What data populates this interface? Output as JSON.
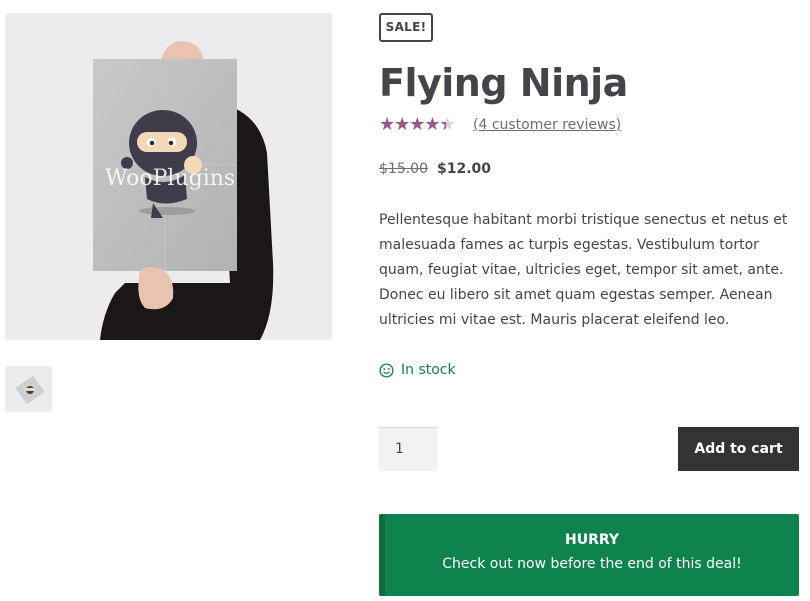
{
  "gallery": {
    "watermark": "WooPlugins",
    "main_image": "poster-held-by-person",
    "thumbnail": "poster-thumbnail"
  },
  "product": {
    "sale_badge": "SALE!",
    "title": "Flying Ninja",
    "rating": 4,
    "rating_max": 5,
    "reviews_link": "(4 customer reviews)",
    "price_old": "$15.00",
    "price_new": "$12.00",
    "description": "Pellentesque habitant morbi tristique senectus et netus et malesuada fames ac turpis egestas. Vestibulum tortor quam, feugiat vitae, ultricies eget, tempor sit amet, ante. Donec eu libero sit amet quam egestas semper. Aenean ultricies mi vitae est. Mauris placerat eleifend leo.",
    "stock_icon": "smiley-icon",
    "stock_text": "In stock",
    "quantity": "1",
    "add_to_cart": "Add to cart"
  },
  "notice": {
    "heading": "HURRY",
    "message": "Check out now before the end of this deal!"
  },
  "colors": {
    "accent_purple": "#96588a",
    "stock_green": "#0f834d",
    "button_dark": "#333333",
    "text": "#43454b"
  }
}
